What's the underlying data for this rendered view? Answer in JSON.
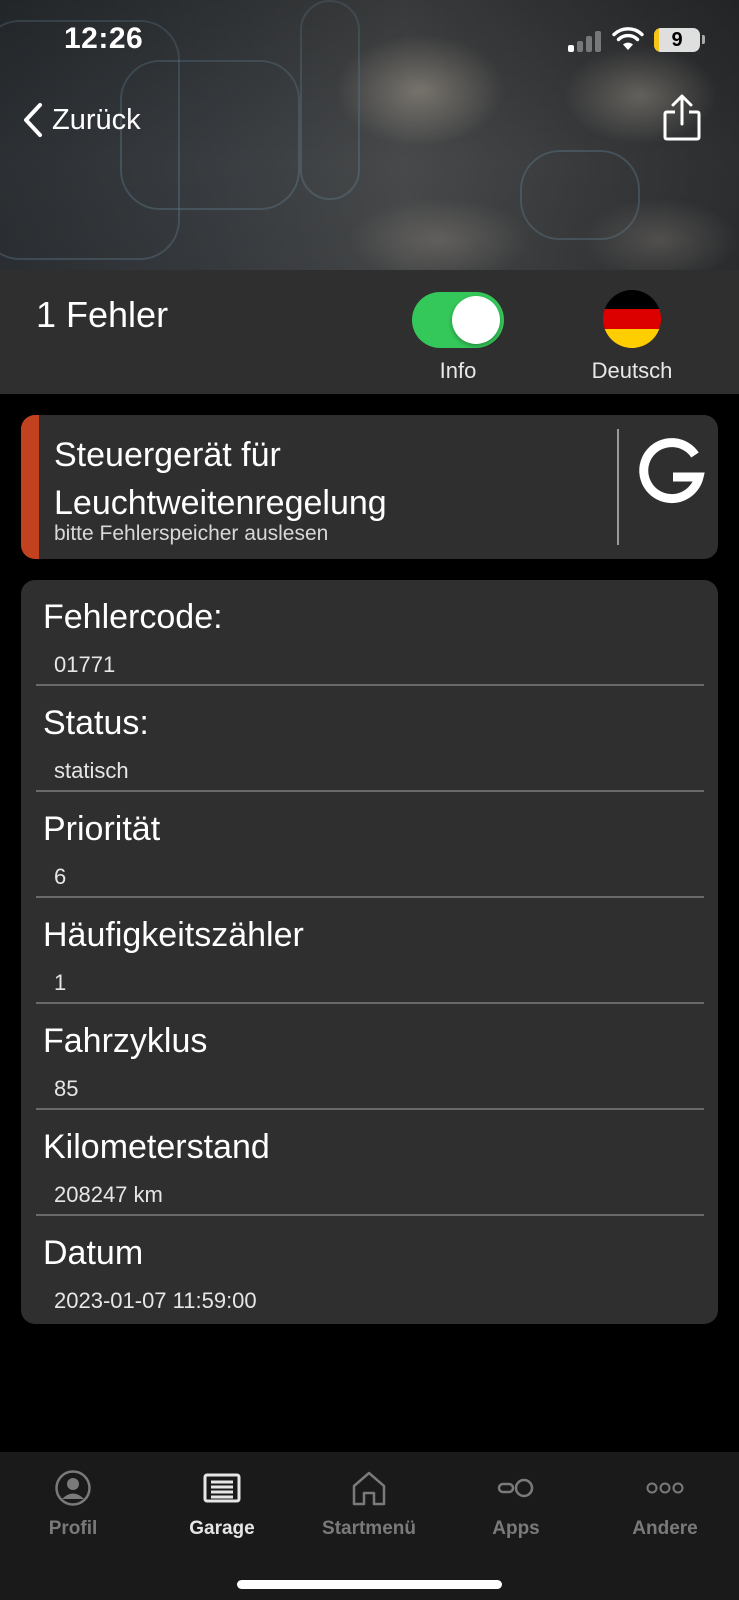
{
  "status_bar": {
    "time": "12:26",
    "battery_level": "9"
  },
  "nav": {
    "back_label": "Zurück"
  },
  "summary": {
    "error_count": "1 Fehler",
    "info_toggle_label": "Info",
    "info_toggle_on": true,
    "language_label": "Deutsch"
  },
  "module": {
    "name": "Steuergerät für Leuchtweitenregelung",
    "hint": "bitte Fehlerspeicher auslesen",
    "accent_color": "#c2411f",
    "search_icon": "google-g-icon"
  },
  "details": [
    {
      "label": "Fehlercode:",
      "value": "01771"
    },
    {
      "label": "Status:",
      "value": "statisch"
    },
    {
      "label": "Priorität",
      "value": "6"
    },
    {
      "label": "Häufigkeitszähler",
      "value": "1"
    },
    {
      "label": "Fahrzyklus",
      "value": "85"
    },
    {
      "label": "Kilometerstand",
      "value": "208247 km"
    },
    {
      "label": "Datum",
      "value": "2023-01-07 11:59:00"
    }
  ],
  "tabs": [
    {
      "label": "Profil",
      "icon": "profile-icon",
      "active": false
    },
    {
      "label": "Garage",
      "icon": "garage-icon",
      "active": true
    },
    {
      "label": "Startmenü",
      "icon": "home-icon",
      "active": false
    },
    {
      "label": "Apps",
      "icon": "apps-icon",
      "active": false
    },
    {
      "label": "Andere",
      "icon": "more-icon",
      "active": false
    }
  ],
  "colors": {
    "toggle_on": "#34c759",
    "card": "#2f2f2f",
    "tabbar": "#1a1a1a"
  }
}
